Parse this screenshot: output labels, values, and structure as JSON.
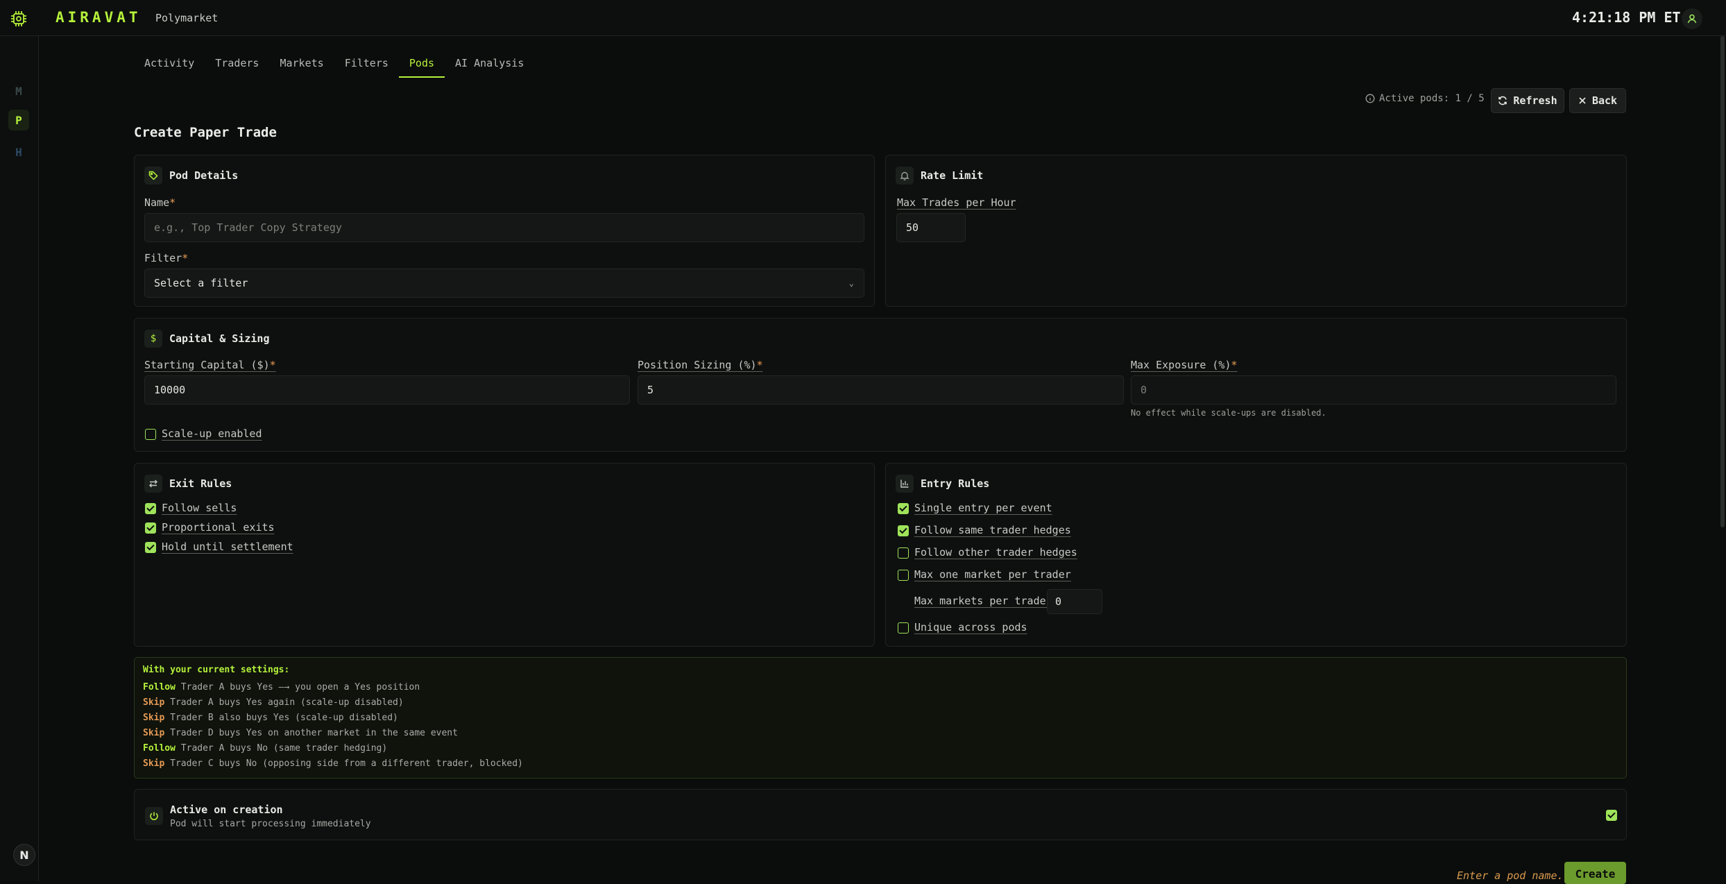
{
  "app": {
    "brand": "AIRAVAT",
    "platform": "Polymarket",
    "clock": "4:21:18 PM ET"
  },
  "sidebar": {
    "items": [
      {
        "label": "M"
      },
      {
        "label": "P"
      },
      {
        "label": "H"
      }
    ],
    "bottom_label": "N"
  },
  "tabs": [
    {
      "label": "Activity"
    },
    {
      "label": "Traders"
    },
    {
      "label": "Markets"
    },
    {
      "label": "Filters"
    },
    {
      "label": "Pods",
      "active": true
    },
    {
      "label": "AI Analysis"
    }
  ],
  "header": {
    "active_pods": "Active pods: 1 / 5",
    "refresh_label": "Refresh",
    "back_label": "Back"
  },
  "page_title": "Create Paper Trade",
  "pod_details": {
    "title": "Pod Details",
    "name_label": "Name",
    "name_placeholder": "e.g., Top Trader Copy Strategy",
    "filter_label": "Filter",
    "filter_value": "Select a filter",
    "required_mark": "*"
  },
  "rate_limit": {
    "title": "Rate Limit",
    "max_trades_label": "Max Trades per Hour",
    "max_trades_value": "50"
  },
  "capital": {
    "title": "Capital & Sizing",
    "icon_glyph": "$",
    "starting_capital_label": "Starting Capital ($)",
    "starting_capital_value": "10000",
    "position_sizing_label": "Position Sizing (%)",
    "position_sizing_value": "5",
    "max_exposure_label": "Max Exposure (%)",
    "max_exposure_value": "0",
    "max_exposure_hint": "No effect while scale-ups are disabled.",
    "scale_up_label": "Scale-up enabled",
    "scale_up_checked": false
  },
  "exit_rules": {
    "title": "Exit Rules",
    "items": [
      {
        "label": "Follow sells",
        "checked": true
      },
      {
        "label": "Proportional exits",
        "checked": true
      },
      {
        "label": "Hold until settlement",
        "checked": true
      }
    ]
  },
  "entry_rules": {
    "title": "Entry Rules",
    "items": [
      {
        "label": "Single entry per event",
        "checked": true
      },
      {
        "label": "Follow same trader hedges",
        "checked": true
      },
      {
        "label": "Follow other trader hedges",
        "checked": false
      },
      {
        "label": "Max one market per trader",
        "checked": false
      }
    ],
    "max_markets_label": "Max markets per trader",
    "max_markets_value": "0",
    "unique_label": "Unique across pods",
    "unique_checked": false
  },
  "summary": {
    "title": "With your current settings:",
    "lines": [
      {
        "action": "Follow",
        "text": "Trader A buys Yes —→ you open a Yes position"
      },
      {
        "action": "Skip",
        "text": "Trader A buys Yes again (scale-up disabled)"
      },
      {
        "action": "Skip",
        "text": "Trader B also buys Yes (scale-up disabled)"
      },
      {
        "action": "Skip",
        "text": "Trader D buys Yes on another market in the same event"
      },
      {
        "action": "Follow",
        "text": "Trader A buys No (same trader hedging)"
      },
      {
        "action": "Skip",
        "text": "Trader C buys No (opposing side from a different trader, blocked)"
      }
    ]
  },
  "active_on_creation": {
    "title": "Active on creation",
    "subtitle": "Pod will start processing immediately",
    "checked": true
  },
  "footer": {
    "hint": "Enter a pod name.",
    "create_label": "Create"
  },
  "colors": {
    "accent": "#b6f23b",
    "skip": "#e59a55",
    "background": "#0b0d0c"
  }
}
